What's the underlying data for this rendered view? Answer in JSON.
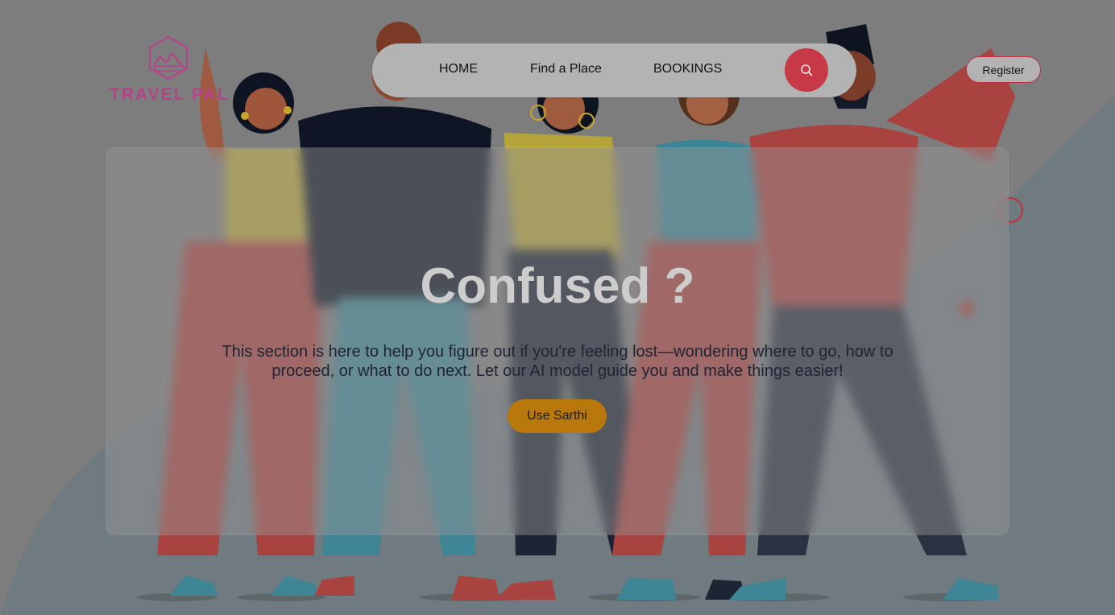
{
  "brand": {
    "logo_text": "TRAVEL PAL"
  },
  "nav": {
    "items": [
      {
        "label": "HOME"
      },
      {
        "label": "Find a Place"
      },
      {
        "label": "BOOKINGS"
      }
    ],
    "search_icon": "search-icon",
    "register_label": "Register"
  },
  "hero": {
    "title": "Confused ?",
    "description": "This section is here to help you figure out if you're feeling lost—wondering where to go, how to proceed, or what to do next. Let our AI model guide you and make things easier!",
    "cta_label": "Use Sarthi"
  },
  "colors": {
    "accent": "#c73946",
    "cta": "#b8780c",
    "navbar": "#b3b3b3"
  }
}
